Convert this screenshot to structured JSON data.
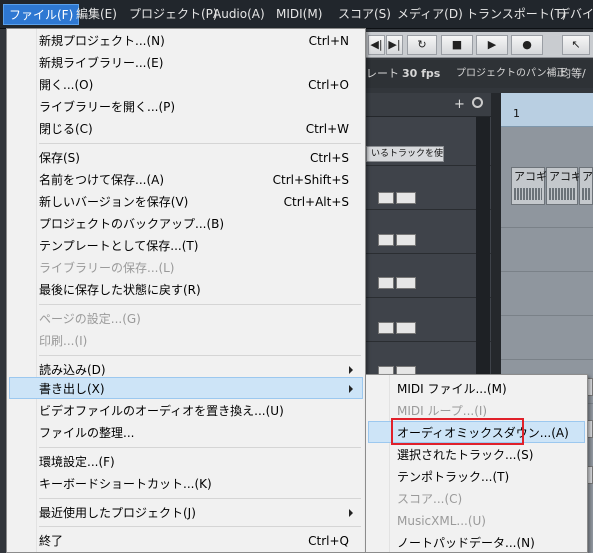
{
  "menubar": {
    "items": [
      "ファイル(F)",
      "編集(E)",
      "プロジェクト(P)",
      "Audio(A)",
      "MIDI(M)",
      "スコア(S)",
      "メディア(D)",
      "トランスポート(T)",
      "デバイス"
    ]
  },
  "daw": {
    "fps": "30 fps",
    "label_left": "レート",
    "pan_label": "プロジェクトのパン補正",
    "right_label": "均等/",
    "use_track": "いるトラックを使用",
    "ruler_num": "1",
    "clip1": "アコギ",
    "clip2": "アコギ",
    "clip3": "ア"
  },
  "file_menu": {
    "items": [
      {
        "label": "新規プロジェクト...(N)",
        "shortcut": "Ctrl+N"
      },
      {
        "label": "新規ライブラリー...(E)",
        "shortcut": ""
      },
      {
        "label": "開く...(O)",
        "shortcut": "Ctrl+O"
      },
      {
        "label": "ライブラリーを開く...(P)",
        "shortcut": ""
      },
      {
        "label": "閉じる(C)",
        "shortcut": "Ctrl+W"
      },
      {
        "label": "保存(S)",
        "shortcut": "Ctrl+S"
      },
      {
        "label": "名前をつけて保存...(A)",
        "shortcut": "Ctrl+Shift+S"
      },
      {
        "label": "新しいバージョンを保存(V)",
        "shortcut": "Ctrl+Alt+S"
      },
      {
        "label": "プロジェクトのバックアップ...(B)",
        "shortcut": ""
      },
      {
        "label": "テンプレートとして保存...(T)",
        "shortcut": ""
      },
      {
        "label": "ライブラリーの保存...(L)",
        "shortcut": ""
      },
      {
        "label": "最後に保存した状態に戻す(R)",
        "shortcut": ""
      },
      {
        "label": "ページの設定...(G)",
        "shortcut": ""
      },
      {
        "label": "印刷...(I)",
        "shortcut": ""
      },
      {
        "label": "読み込み(D)",
        "shortcut": ""
      },
      {
        "label": "書き出し(X)",
        "shortcut": ""
      },
      {
        "label": "ビデオファイルのオーディオを置き換え...(U)",
        "shortcut": ""
      },
      {
        "label": "ファイルの整理...",
        "shortcut": ""
      },
      {
        "label": "環境設定...(F)",
        "shortcut": ""
      },
      {
        "label": "キーボードショートカット...(K)",
        "shortcut": ""
      },
      {
        "label": "最近使用したプロジェクト(J)",
        "shortcut": ""
      },
      {
        "label": "終了",
        "shortcut": "Ctrl+Q"
      }
    ]
  },
  "export_menu": {
    "items": [
      {
        "label": "MIDI ファイル...(M)"
      },
      {
        "label": "MIDI ループ...(I)"
      },
      {
        "label": "オーディオミックスダウン...(A)"
      },
      {
        "label": "選択されたトラック...(S)"
      },
      {
        "label": "テンポトラック...(T)"
      },
      {
        "label": "スコア...(C)"
      },
      {
        "label": "MusicXML...(U)"
      },
      {
        "label": "ノートパッドデータ...(N)"
      }
    ]
  }
}
